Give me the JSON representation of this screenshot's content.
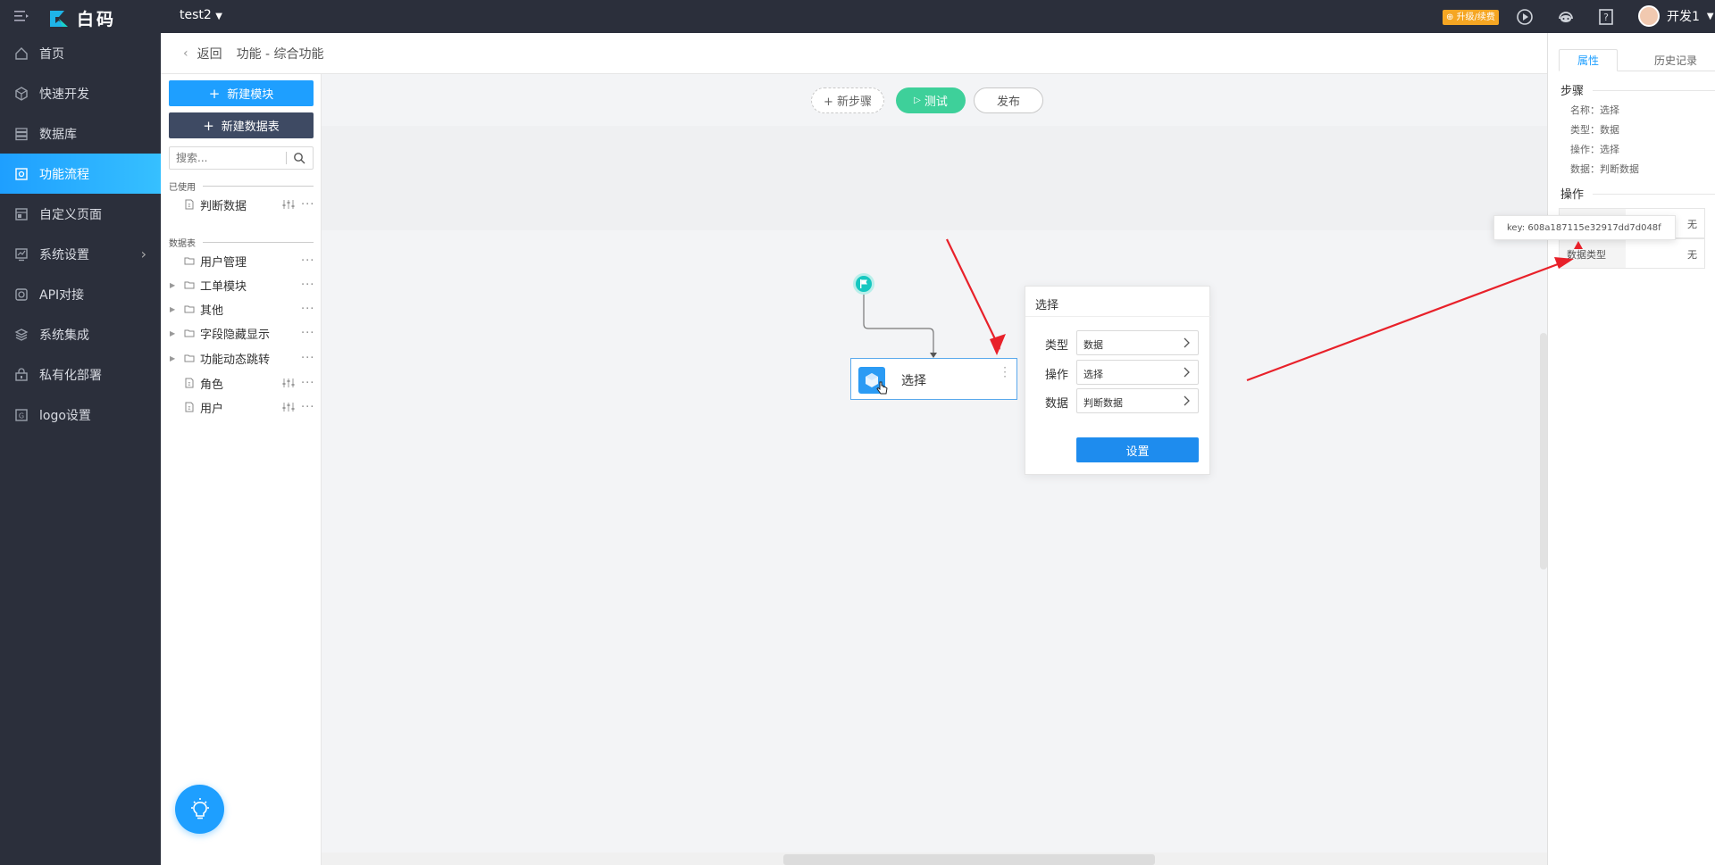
{
  "topbar": {
    "logo_text": "白码",
    "project_name": "test2",
    "upgrade_label": "⊕ 升级/续费",
    "user_name": "开发1"
  },
  "nav": {
    "items": [
      {
        "label": "首页",
        "icon": "home-icon"
      },
      {
        "label": "快速开发",
        "icon": "cube-icon"
      },
      {
        "label": "数据库",
        "icon": "database-icon"
      },
      {
        "label": "功能流程",
        "icon": "flow-icon"
      },
      {
        "label": "自定义页面",
        "icon": "page-icon"
      },
      {
        "label": "系统设置",
        "icon": "chart-icon"
      },
      {
        "label": "API对接",
        "icon": "api-icon"
      },
      {
        "label": "系统集成",
        "icon": "layers-icon"
      },
      {
        "label": "私有化部署",
        "icon": "lock-icon"
      },
      {
        "label": "logo设置",
        "icon": "logo-icon"
      }
    ],
    "active_index": 3
  },
  "crumb": {
    "back": "返回",
    "path": "功能 - 综合功能"
  },
  "modules": {
    "new_module": "新建模块",
    "new_table": "新建数据表",
    "search_placeholder": "搜索...",
    "used_title": "已使用",
    "used_items": [
      "判断数据"
    ],
    "table_title": "数据表",
    "table_items": [
      "用户管理",
      "工单模块",
      "其他",
      "字段隐藏显示",
      "功能动态跳转",
      "角色",
      "用户"
    ]
  },
  "toolbar": {
    "new_step": "+ 新步骤",
    "test": "测试",
    "publish": "发布"
  },
  "flow": {
    "step_label": "选择"
  },
  "popover": {
    "title": "选择",
    "rows": [
      {
        "label": "类型",
        "value": "数据"
      },
      {
        "label": "操作",
        "value": "选择"
      },
      {
        "label": "数据",
        "value": "判断数据"
      }
    ],
    "save": "设置"
  },
  "right": {
    "tab_props": "属性",
    "tab_history": "历史记录",
    "step_section": "步骤",
    "name_line": "名称：选择",
    "type_line": "类型：数据",
    "op_line": "操作：选择",
    "data_line": "数据：判断数据",
    "op_section": "操作",
    "row1_value": "无",
    "row2_key": "数据类型",
    "row2_value": "无",
    "tooltip": "key: 608a187115e32917dd7d048f"
  },
  "colors": {
    "accent": "#1e9fff",
    "test_green": "#3ed09a",
    "dark_bg": "#2b2f3b",
    "annotation_red": "#e8212a"
  }
}
